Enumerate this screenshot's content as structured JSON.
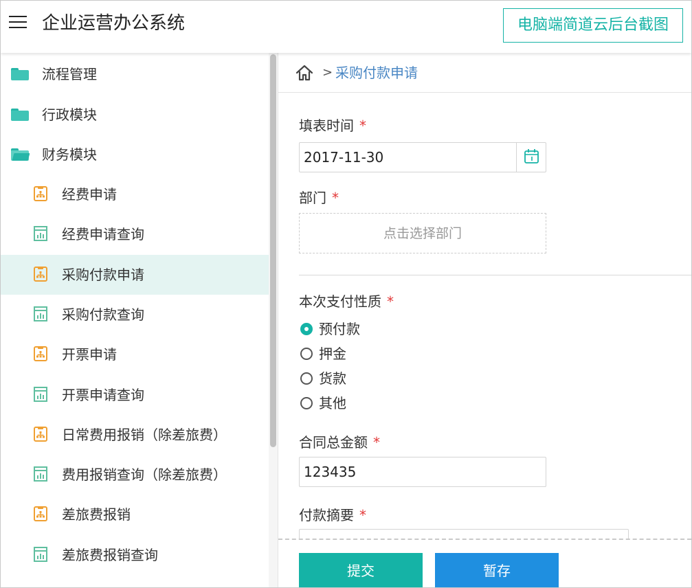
{
  "header": {
    "app_title": "企业运营办公系统",
    "badge_text": "电脑端简道云后台截图"
  },
  "sidebar": {
    "groups": [
      {
        "label": "流程管理",
        "icon": "folder-icon"
      },
      {
        "label": "行政模块",
        "icon": "folder-icon"
      },
      {
        "label": "财务模块",
        "icon": "folder-open-icon"
      }
    ],
    "items": [
      {
        "label": "经费申请",
        "icon": "org-chart-form-icon"
      },
      {
        "label": "经费申请查询",
        "icon": "report-chart-icon"
      },
      {
        "label": "采购付款申请",
        "icon": "org-chart-form-icon",
        "active": true
      },
      {
        "label": "采购付款查询",
        "icon": "report-chart-icon"
      },
      {
        "label": "开票申请",
        "icon": "org-chart-form-icon"
      },
      {
        "label": "开票申请查询",
        "icon": "report-chart-icon"
      },
      {
        "label": "日常费用报销（除差旅费）",
        "icon": "org-chart-form-icon"
      },
      {
        "label": "费用报销查询（除差旅费）",
        "icon": "report-chart-icon"
      },
      {
        "label": "差旅费报销",
        "icon": "org-chart-form-icon"
      },
      {
        "label": "差旅费报销查询",
        "icon": "report-chart-icon"
      }
    ]
  },
  "breadcrumb": {
    "separator": ">",
    "current": "采购付款申请"
  },
  "form": {
    "required_mark": "*",
    "date_label": "填表时间",
    "date_value": "2017-11-30",
    "dept_label": "部门",
    "dept_placeholder": "点击选择部门",
    "payment_type_label": "本次支付性质",
    "payment_options": [
      "预付款",
      "押金",
      "货款",
      "其他"
    ],
    "payment_selected": "预付款",
    "amount_label": "合同总金额",
    "amount_value": "123435",
    "summary_label": "付款摘要"
  },
  "actions": {
    "submit_label": "提交",
    "save_label": "暂存"
  },
  "colors": {
    "accent_teal": "#15b3a6",
    "save_blue": "#1f8fe0",
    "required_red": "#e23a3a",
    "breadcrumb_blue": "#4a87c4",
    "form_icon_orange": "#f0a032",
    "report_icon_green": "#5fbf9f"
  }
}
